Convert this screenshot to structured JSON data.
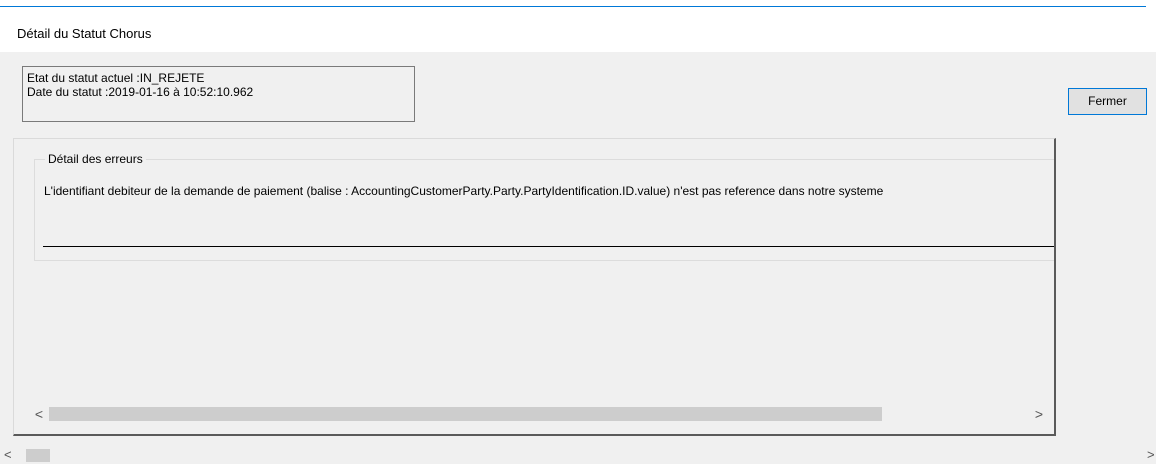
{
  "window": {
    "title": "Détail du Statut Chorus"
  },
  "status": {
    "state_line": "Etat du statut actuel :IN_REJETE",
    "date_line": "Date du statut :2019-01-16 à 10:52:10.962"
  },
  "buttons": {
    "close_label": "Fermer"
  },
  "errors": {
    "group_label": "Détail des erreurs",
    "message": "L'identifiant debiteur de la demande de paiement (balise : AccountingCustomerParty.Party.PartyIdentification.ID.value) n'est pas reference dans notre systeme"
  },
  "scrollbars": {
    "left_arrow": "<",
    "right_arrow": ">"
  },
  "icons": [
    "chevron-left-icon",
    "chevron-right-icon"
  ],
  "colors": {
    "accent": "#0078d7",
    "background": "#f0f0f0",
    "title_background": "#ffffff",
    "scroll_thumb": "#cdcdcd"
  }
}
